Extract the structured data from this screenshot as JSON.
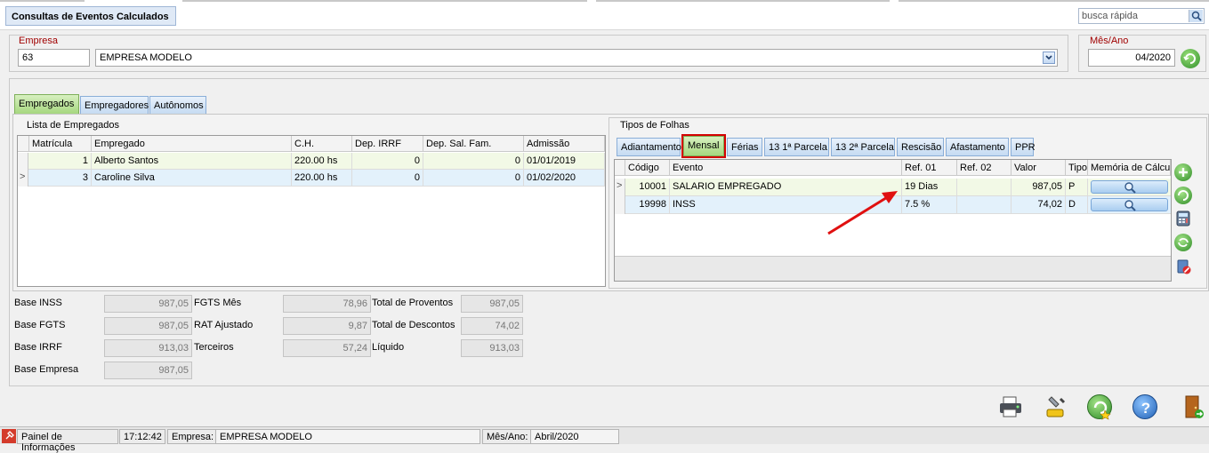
{
  "window": {
    "title": "Consultas de Eventos Calculados",
    "search_placeholder": "busca rápida"
  },
  "empresa": {
    "label": "Empresa",
    "code": "63",
    "name": "EMPRESA MODELO"
  },
  "periodo": {
    "label": "Mês/Ano",
    "value": "04/2020"
  },
  "main_tabs": [
    "Empregados",
    "Empregadores",
    "Autônomos"
  ],
  "employees": {
    "title": "Lista de Empregados",
    "columns": [
      "Matrícula",
      "Empregado",
      "C.H.",
      "Dep. IRRF",
      "Dep. Sal. Fam.",
      "Admissão"
    ],
    "rows": [
      [
        "1",
        "Alberto Santos",
        "220.00 hs",
        "0",
        "0",
        "01/01/2019"
      ],
      [
        "3",
        "Caroline Silva",
        "220.00 hs",
        "0",
        "0",
        "01/02/2020"
      ]
    ]
  },
  "folhas": {
    "title": "Tipos de Folhas",
    "tabs": [
      "Adiantamento",
      "Mensal",
      "Férias",
      "13 1ª Parcela",
      "13 2ª Parcela",
      "Rescisão",
      "Afastamento",
      "PPR"
    ],
    "columns": [
      "Código",
      "Evento",
      "Ref. 01",
      "Ref. 02",
      "Valor",
      "Tipo",
      "Memória de Cálcul"
    ],
    "rows": [
      [
        "10001",
        "SALARIO EMPREGADO",
        "19 Dias",
        "",
        "987,05",
        "P"
      ],
      [
        "19998",
        "INSS",
        "7.5 %",
        "",
        "74,02",
        "D"
      ]
    ]
  },
  "totals": {
    "base_inss_label": "Base INSS",
    "base_inss": "987,05",
    "base_fgts_label": "Base FGTS",
    "base_fgts": "987,05",
    "base_irrf_label": "Base IRRF",
    "base_irrf": "913,03",
    "base_empresa_label": "Base Empresa",
    "base_empresa": "987,05",
    "fgts_mes_label": "FGTS Mês",
    "fgts_mes": "78,96",
    "rat_label": "RAT Ajustado",
    "rat": "9,87",
    "terceiros_label": "Terceiros",
    "terceiros": "57,24",
    "proventos_label": "Total de Proventos",
    "proventos": "987,05",
    "descontos_label": "Total de Descontos",
    "descontos": "74,02",
    "liquido_label": "Líquido",
    "liquido": "913,03"
  },
  "status": {
    "painel": "Painel de Informações",
    "time": "17:12:42",
    "empresa_label": "Empresa:",
    "empresa": "EMPRESA MODELO",
    "mes_label": "Mês/Ano:",
    "mes": "Abril/2020"
  },
  "colors": {
    "active_tab": "#a6d77f",
    "highlight": "#d20000",
    "arrow": "#e01010"
  }
}
